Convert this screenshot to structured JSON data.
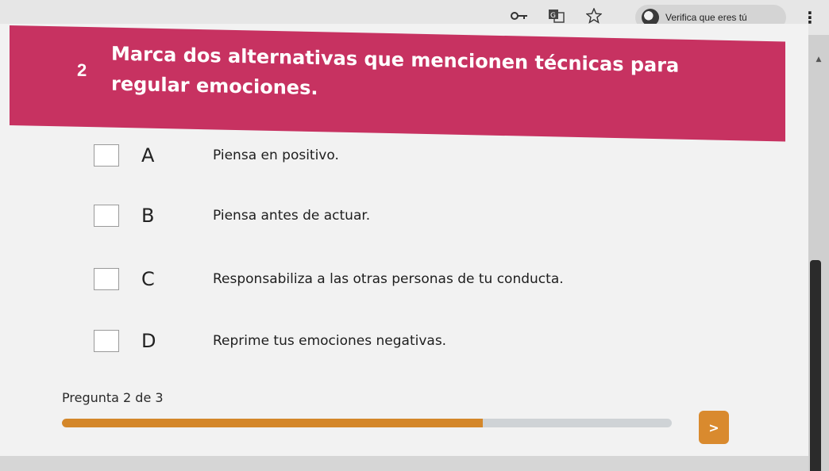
{
  "browser": {
    "profile_label": "Verifica que eres tú",
    "menu_glyph": "⋮",
    "icons": [
      "key-icon",
      "translate-icon",
      "star-icon",
      "avatar-icon",
      "menu-icon"
    ]
  },
  "question": {
    "number": "2",
    "text": "Marca dos alternativas que mencionen técnicas para regular emociones."
  },
  "options": [
    {
      "letter": "A",
      "text": "Piensa en positivo.",
      "checked": false
    },
    {
      "letter": "B",
      "text": "Piensa antes de actuar.",
      "checked": false
    },
    {
      "letter": "C",
      "text": "Responsabiliza a las otras personas de tu conducta.",
      "checked": false
    },
    {
      "letter": "D",
      "text": "Reprime tus emociones negativas.",
      "checked": false
    }
  ],
  "progress": {
    "label": "Pregunta 2 de 3",
    "fraction": 0.69
  },
  "navigation": {
    "next_label": ">"
  },
  "colors": {
    "banner": "#c73261",
    "progress_fill": "#d4872a",
    "next_button": "#d98a2e"
  }
}
